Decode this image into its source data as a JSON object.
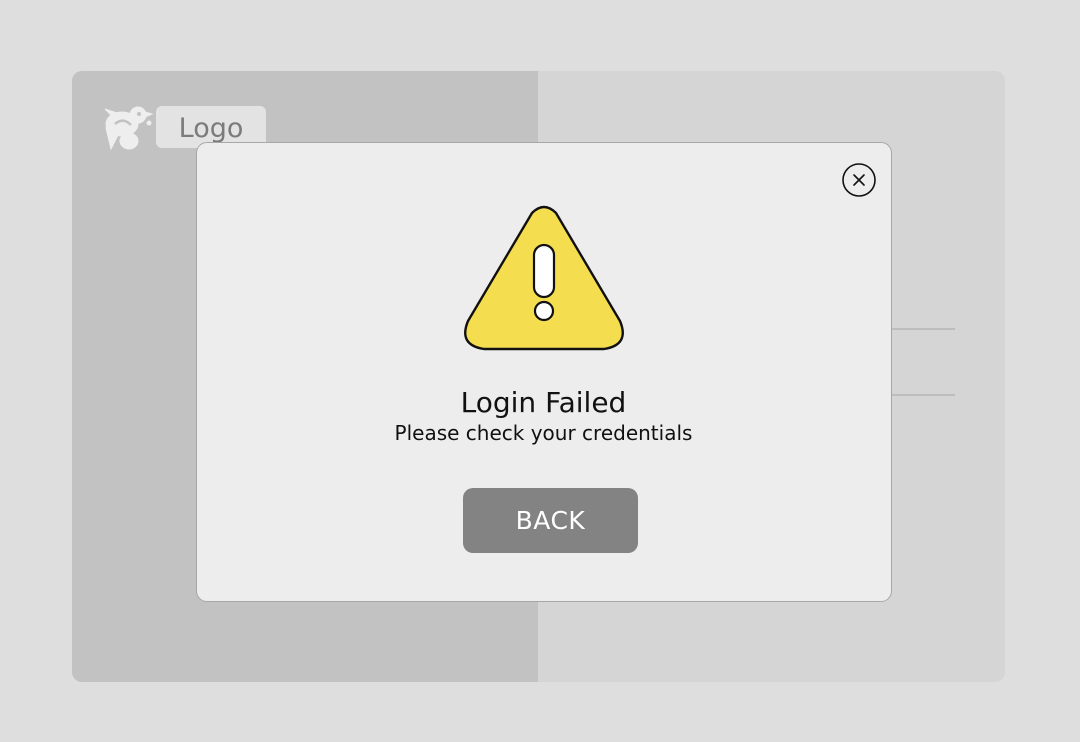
{
  "background": {
    "logo": {
      "text": "Logo",
      "icon": "bird-logo-icon"
    }
  },
  "dialog": {
    "icon": "warning-icon",
    "title": "Login Failed",
    "message": "Please check your credentials",
    "back_label": "BACK",
    "close_icon": "close-icon"
  },
  "colors": {
    "page_background": "#dedede",
    "left_pane": "#c2c2c2",
    "right_pane": "#d5d5d5",
    "dialog_background": "#ededed",
    "warning_fill": "#f5dd50",
    "button_background": "#838383",
    "button_text": "#ffffff"
  }
}
